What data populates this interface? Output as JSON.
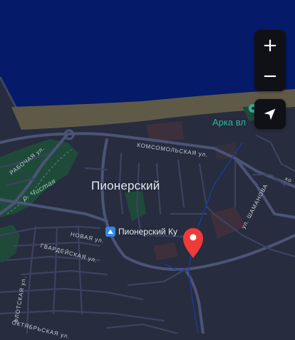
{
  "colors": {
    "water": "#061a6a",
    "land": "#272c3e",
    "road": "#3d4563",
    "road_major": "#4b5476",
    "beach": "#625c4a",
    "park": "#1f4a3a",
    "building": "#3f2f3a",
    "marker": "#f03a3a",
    "poi_icon": "#2f8ae6",
    "poi_teal": "#2fb39a"
  },
  "controls": {
    "zoom_in": "+",
    "zoom_out": "−",
    "locate_icon": "navigation-arrow-icon"
  },
  "labels": {
    "district": "Пионерский",
    "poi_kurort": "Пионерский Ку",
    "poi_arka": "Арка вл",
    "street_komsomolskaya": "КОМСОМОЛЬСКАЯ ул.",
    "street_rabochaya": "РАБОЧАЯ ул.",
    "river_chistaya": "р. Чистая",
    "street_shamanova": "ул. ШАМАНОВА",
    "street_novaya": "НОВАЯ ул.",
    "street_gvardeyskaya": "ГВАРДЕЙСКАЯ ул.",
    "street_flotskaya": "ФЛОТСКАЯ ул.",
    "street_oktyabrskaya": "ОКТЯБРЬСКАЯ ул.",
    "street_right_edge": "ко"
  }
}
